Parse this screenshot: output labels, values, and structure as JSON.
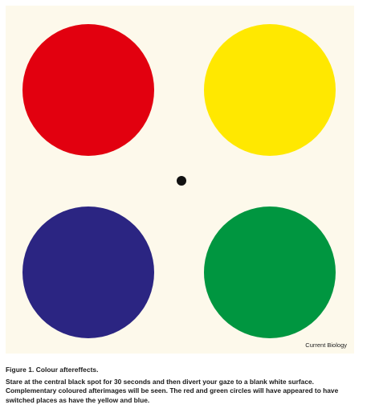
{
  "figure": {
    "source_label": "Current Biology",
    "background_color": "#fdf9eb",
    "dot_color": "#111111",
    "circles": [
      {
        "name": "red",
        "color": "#e2000f"
      },
      {
        "name": "yellow",
        "color": "#ffe800"
      },
      {
        "name": "blue",
        "color": "#2b2582"
      },
      {
        "name": "green",
        "color": "#009640"
      }
    ]
  },
  "caption": {
    "title": "Figure 1. Colour aftereffects.",
    "text": "Stare at the central black spot for 30 seconds and then divert your gaze to a blank white surface. Complementary coloured afterimages will be seen. The red and green circles will have appeared to have switched places as have the yellow and blue."
  }
}
